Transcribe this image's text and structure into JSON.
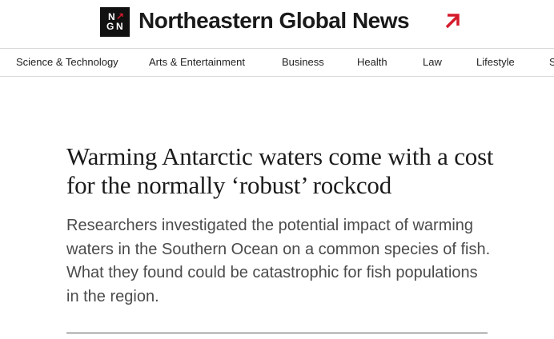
{
  "brand": {
    "logo_letters": [
      "N",
      "G",
      "N"
    ],
    "title": "Northeastern Global News",
    "accent_color": "#d41b2c",
    "logo_icon": "northeastern-logo",
    "arrow_icon": "arrow-up-right-icon"
  },
  "nav": {
    "items": [
      "Science & Technology",
      "Arts & Entertainment",
      "Business",
      "Health",
      "Law",
      "Lifestyle",
      "S"
    ]
  },
  "article": {
    "headline": "Warming Antarctic waters come with a cost for the normally ‘robust’ rockcod",
    "dek": "Researchers investigated the potential impact of warming waters in the Southern Ocean on a common species of fish. What they found could be catastrophic for fish populations in the region."
  }
}
